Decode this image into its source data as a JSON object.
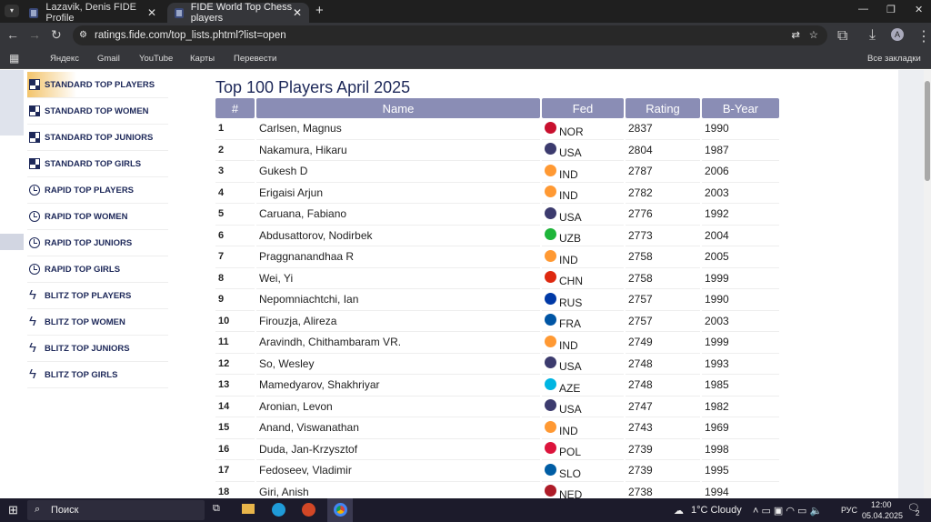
{
  "browser": {
    "tabs": [
      {
        "title": "Lazavik, Denis FIDE Profile"
      },
      {
        "title": "FIDE World Top Chess players"
      }
    ],
    "url": "ratings.fide.com/top_lists.phtml?list=open",
    "profile_initial": "A",
    "bookmarks": [
      "Яндекс",
      "Gmail",
      "YouTube",
      "Карты",
      "Перевести"
    ],
    "all_bookmarks": "Все закладки"
  },
  "sidebar": [
    {
      "label": "STANDARD TOP PLAYERS",
      "icon": "chessboard"
    },
    {
      "label": "STANDARD TOP WOMEN",
      "icon": "chessboard"
    },
    {
      "label": "STANDARD TOP JUNIORS",
      "icon": "chessboard"
    },
    {
      "label": "STANDARD TOP GIRLS",
      "icon": "chessboard"
    },
    {
      "label": "RAPID TOP PLAYERS",
      "icon": "clock"
    },
    {
      "label": "RAPID TOP WOMEN",
      "icon": "clock"
    },
    {
      "label": "RAPID TOP JUNIORS",
      "icon": "clock"
    },
    {
      "label": "RAPID TOP GIRLS",
      "icon": "clock"
    },
    {
      "label": "BLITZ TOP PLAYERS",
      "icon": "lightning"
    },
    {
      "label": "BLITZ TOP WOMEN",
      "icon": "lightning"
    },
    {
      "label": "BLITZ TOP JUNIORS",
      "icon": "lightning"
    },
    {
      "label": "BLITZ TOP GIRLS",
      "icon": "lightning"
    }
  ],
  "main": {
    "title": "Top 100 Players April 2025",
    "columns": [
      "#",
      "Name",
      "Fed",
      "Rating",
      "B-Year"
    ],
    "rows": [
      [
        "1",
        "Carlsen, Magnus",
        "NOR",
        "2837",
        "1990"
      ],
      [
        "2",
        "Nakamura, Hikaru",
        "USA",
        "2804",
        "1987"
      ],
      [
        "3",
        "Gukesh D",
        "IND",
        "2787",
        "2006"
      ],
      [
        "4",
        "Erigaisi Arjun",
        "IND",
        "2782",
        "2003"
      ],
      [
        "5",
        "Caruana, Fabiano",
        "USA",
        "2776",
        "1992"
      ],
      [
        "6",
        "Abdusattorov, Nodirbek",
        "UZB",
        "2773",
        "2004"
      ],
      [
        "7",
        "Praggnanandhaa R",
        "IND",
        "2758",
        "2005"
      ],
      [
        "8",
        "Wei, Yi",
        "CHN",
        "2758",
        "1999"
      ],
      [
        "9",
        "Nepomniachtchi, Ian",
        "RUS",
        "2757",
        "1990"
      ],
      [
        "10",
        "Firouzja, Alireza",
        "FRA",
        "2757",
        "2003"
      ],
      [
        "11",
        "Aravindh, Chithambaram VR.",
        "IND",
        "2749",
        "1999"
      ],
      [
        "12",
        "So, Wesley",
        "USA",
        "2748",
        "1993"
      ],
      [
        "13",
        "Mamedyarov, Shakhriyar",
        "AZE",
        "2748",
        "1985"
      ],
      [
        "14",
        "Aronian, Levon",
        "USA",
        "2747",
        "1982"
      ],
      [
        "15",
        "Anand, Viswanathan",
        "IND",
        "2743",
        "1969"
      ],
      [
        "16",
        "Duda, Jan-Krzysztof",
        "POL",
        "2739",
        "1998"
      ],
      [
        "17",
        "Fedoseev, Vladimir",
        "SLO",
        "2739",
        "1995"
      ],
      [
        "18",
        "Giri, Anish",
        "NED",
        "2738",
        "1994"
      ]
    ]
  },
  "flag_colors": {
    "NOR": "#c8102e",
    "USA": "#3c3b6e",
    "IND": "#ff9933",
    "UZB": "#1eb53a",
    "CHN": "#de2910",
    "RUS": "#0039a6",
    "FRA": "#0055a4",
    "AZE": "#00b5e2",
    "POL": "#dc143c",
    "SLO": "#005da4",
    "NED": "#ae1c28"
  },
  "taskbar": {
    "search": "Поиск",
    "weather": "1°C  Cloudy",
    "lang": "РУС",
    "time": "12:00",
    "date": "05.04.2025",
    "notifications": "2"
  }
}
